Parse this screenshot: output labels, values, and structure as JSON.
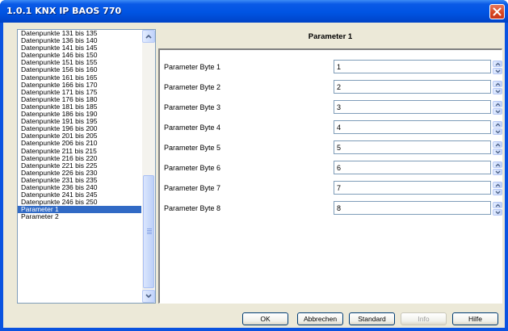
{
  "window": {
    "title": "1.0.1 KNX IP BAOS 770"
  },
  "list": {
    "items": [
      "Datenpunkte 131 bis 135",
      "Datenpunkte 136 bis 140",
      "Datenpunkte 141 bis 145",
      "Datenpunkte 146 bis 150",
      "Datenpunkte 151 bis 155",
      "Datenpunkte 156 bis 160",
      "Datenpunkte 161 bis 165",
      "Datenpunkte 166 bis 170",
      "Datenpunkte 171 bis 175",
      "Datenpunkte 176 bis 180",
      "Datenpunkte 181 bis 185",
      "Datenpunkte 186 bis 190",
      "Datenpunkte 191 bis 195",
      "Datenpunkte 196 bis 200",
      "Datenpunkte 201 bis 205",
      "Datenpunkte 206 bis 210",
      "Datenpunkte 211 bis 215",
      "Datenpunkte 216 bis 220",
      "Datenpunkte 221 bis 225",
      "Datenpunkte 226 bis 230",
      "Datenpunkte 231 bis 235",
      "Datenpunkte 236 bis 240",
      "Datenpunkte 241 bis 245",
      "Datenpunkte 246 bis 250",
      "Parameter 1",
      "Parameter 2"
    ],
    "selected_index": 24
  },
  "page": {
    "title": "Parameter 1",
    "params": [
      {
        "label": "Parameter Byte 1",
        "value": "1"
      },
      {
        "label": "Parameter Byte 2",
        "value": "2"
      },
      {
        "label": "Parameter Byte 3",
        "value": "3"
      },
      {
        "label": "Parameter Byte 4",
        "value": "4"
      },
      {
        "label": "Parameter Byte 5",
        "value": "5"
      },
      {
        "label": "Parameter Byte 6",
        "value": "6"
      },
      {
        "label": "Parameter Byte 7",
        "value": "7"
      },
      {
        "label": "Parameter Byte 8",
        "value": "8"
      }
    ]
  },
  "buttons": {
    "ok": "OK",
    "cancel": "Abbrechen",
    "standard": "Standard",
    "info": "Info",
    "help": "Hilfe"
  },
  "colors": {
    "title_bar": "#0054e3",
    "selection": "#316ac5",
    "dialog_bg": "#ece9d8"
  }
}
